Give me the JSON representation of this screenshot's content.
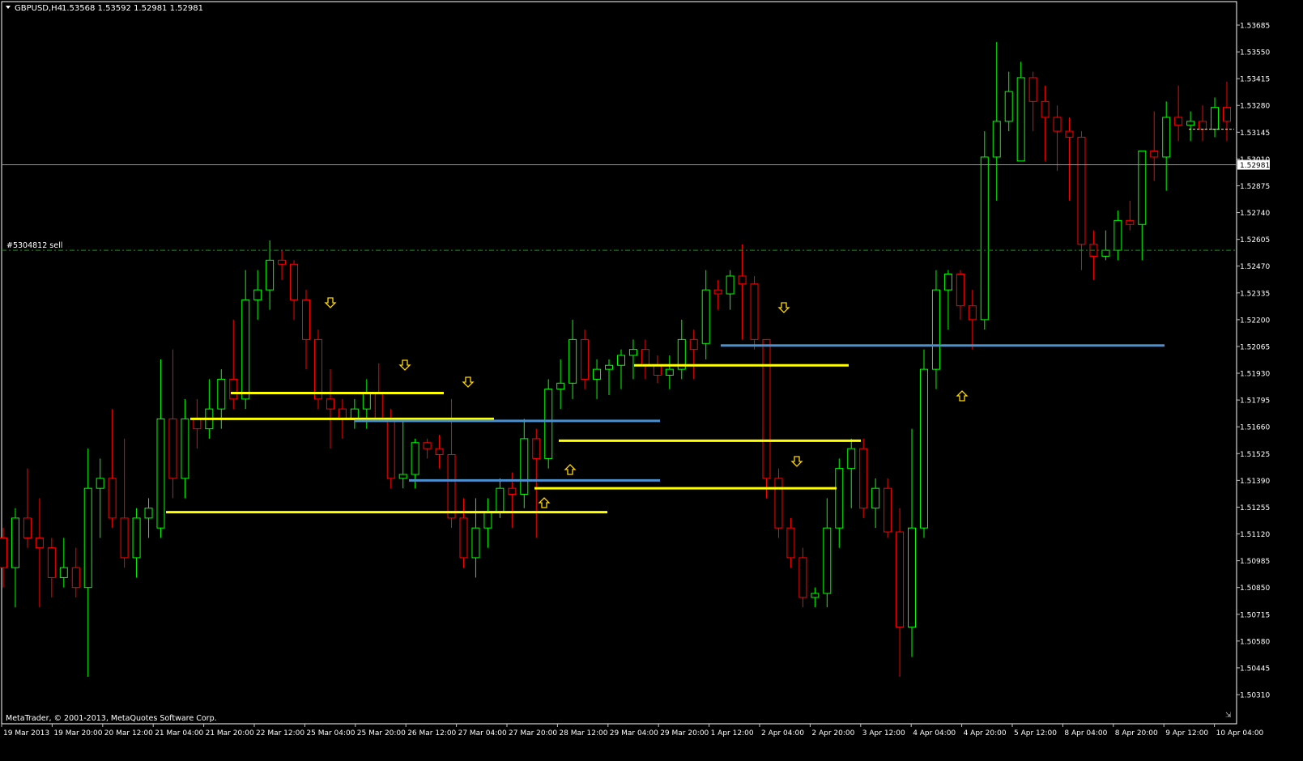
{
  "header": {
    "symbol": "GBPUSD,H4",
    "ohlc": "1.53568 1.53592 1.52981 1.52981"
  },
  "footer": {
    "copyright": "MetaTrader, © 2001-2013, MetaQuotes Software Corp."
  },
  "order": {
    "label": "#5304812 sell",
    "price": 1.5255
  },
  "current_price_label": "1.52981",
  "colors": {
    "background": "#000000",
    "bull": "#00ff00",
    "bear": "#ff0000",
    "axis": "#c0c0c0",
    "support_line": "#ffff00",
    "resistance_line": "#4a8fd0",
    "arrow": "#ffd700",
    "bid_line": "#8c96a8",
    "order_line": "#00a000"
  },
  "chart_data": {
    "type": "candlestick",
    "symbol": "GBPUSD",
    "timeframe": "H4",
    "y_range": [
      1.502,
      1.5375
    ],
    "y_ticks": [
      "1.53685",
      "1.53550",
      "1.53415",
      "1.53280",
      "1.53145",
      "1.53010",
      "1.52875",
      "1.52740",
      "1.52605",
      "1.52470",
      "1.52335",
      "1.52200",
      "1.52065",
      "1.51930",
      "1.51795",
      "1.51660",
      "1.51525",
      "1.51390",
      "1.51255",
      "1.51120",
      "1.50985",
      "1.50850",
      "1.50715",
      "1.50580",
      "1.50445",
      "1.50310"
    ],
    "x_labels": [
      "19 Mar 2013",
      "19 Mar 20:00",
      "20 Mar 12:00",
      "21 Mar 04:00",
      "21 Mar 20:00",
      "22 Mar 12:00",
      "25 Mar 04:00",
      "25 Mar 20:00",
      "26 Mar 12:00",
      "27 Mar 04:00",
      "27 Mar 20:00",
      "28 Mar 12:00",
      "29 Mar 04:00",
      "29 Mar 20:00",
      "1 Apr 12:00",
      "2 Apr 04:00",
      "2 Apr 20:00",
      "3 Apr 12:00",
      "4 Apr 04:00",
      "4 Apr 20:00",
      "5 Apr 12:00",
      "8 Apr 04:00",
      "8 Apr 20:00",
      "9 Apr 12:00",
      "10 Apr 04:00"
    ],
    "candles": [
      [
        1.511,
        1.5115,
        1.5085,
        1.5095
      ],
      [
        1.5095,
        1.5125,
        1.5075,
        1.512
      ],
      [
        1.512,
        1.5145,
        1.5105,
        1.511
      ],
      [
        1.511,
        1.513,
        1.5075,
        1.5105
      ],
      [
        1.5105,
        1.511,
        1.508,
        1.509
      ],
      [
        1.509,
        1.511,
        1.5085,
        1.5095
      ],
      [
        1.5095,
        1.5105,
        1.508,
        1.5085
      ],
      [
        1.5085,
        1.5155,
        1.504,
        1.5135
      ],
      [
        1.5135,
        1.515,
        1.511,
        1.514
      ],
      [
        1.514,
        1.5175,
        1.5115,
        1.512
      ],
      [
        1.512,
        1.516,
        1.5095,
        1.51
      ],
      [
        1.51,
        1.5125,
        1.509,
        1.512
      ],
      [
        1.512,
        1.513,
        1.511,
        1.5125
      ],
      [
        1.5115,
        1.52,
        1.511,
        1.517
      ],
      [
        1.517,
        1.5205,
        1.513,
        1.514
      ],
      [
        1.514,
        1.518,
        1.513,
        1.517
      ],
      [
        1.517,
        1.518,
        1.5155,
        1.5165
      ],
      [
        1.5165,
        1.519,
        1.516,
        1.5175
      ],
      [
        1.5175,
        1.5195,
        1.5165,
        1.519
      ],
      [
        1.519,
        1.522,
        1.5175,
        1.518
      ],
      [
        1.518,
        1.5245,
        1.5175,
        1.523
      ],
      [
        1.523,
        1.5245,
        1.522,
        1.5235
      ],
      [
        1.5235,
        1.526,
        1.5225,
        1.525
      ],
      [
        1.525,
        1.5255,
        1.524,
        1.5248
      ],
      [
        1.5248,
        1.525,
        1.522,
        1.523
      ],
      [
        1.523,
        1.5235,
        1.5195,
        1.521
      ],
      [
        1.521,
        1.5215,
        1.5175,
        1.518
      ],
      [
        1.518,
        1.5195,
        1.5155,
        1.5175
      ],
      [
        1.5175,
        1.518,
        1.516,
        1.517
      ],
      [
        1.517,
        1.518,
        1.5165,
        1.5175
      ],
      [
        1.5175,
        1.519,
        1.5165,
        1.5183
      ],
      [
        1.5183,
        1.5198,
        1.517,
        1.517
      ],
      [
        1.517,
        1.5175,
        1.5135,
        1.514
      ],
      [
        1.514,
        1.517,
        1.5135,
        1.5142
      ],
      [
        1.5142,
        1.516,
        1.5135,
        1.5158
      ],
      [
        1.5158,
        1.516,
        1.515,
        1.5155
      ],
      [
        1.5155,
        1.5162,
        1.5145,
        1.5152
      ],
      [
        1.5152,
        1.518,
        1.5115,
        1.512
      ],
      [
        1.512,
        1.513,
        1.5095,
        1.51
      ],
      [
        1.51,
        1.513,
        1.509,
        1.5115
      ],
      [
        1.5115,
        1.513,
        1.5105,
        1.5123
      ],
      [
        1.5123,
        1.514,
        1.512,
        1.5135
      ],
      [
        1.5135,
        1.5143,
        1.5115,
        1.5132
      ],
      [
        1.5132,
        1.517,
        1.5125,
        1.516
      ],
      [
        1.516,
        1.5165,
        1.511,
        1.515
      ],
      [
        1.515,
        1.519,
        1.5145,
        1.5185
      ],
      [
        1.5185,
        1.52,
        1.5175,
        1.5188
      ],
      [
        1.5188,
        1.522,
        1.518,
        1.521
      ],
      [
        1.521,
        1.5215,
        1.5185,
        1.519
      ],
      [
        1.519,
        1.52,
        1.518,
        1.5195
      ],
      [
        1.5195,
        1.52,
        1.5182,
        1.5197
      ],
      [
        1.5197,
        1.5205,
        1.5185,
        1.5202
      ],
      [
        1.5202,
        1.521,
        1.519,
        1.5205
      ],
      [
        1.5205,
        1.521,
        1.519,
        1.5197
      ],
      [
        1.5197,
        1.5202,
        1.5188,
        1.5192
      ],
      [
        1.5192,
        1.5202,
        1.5185,
        1.5195
      ],
      [
        1.5195,
        1.522,
        1.519,
        1.521
      ],
      [
        1.521,
        1.5215,
        1.519,
        1.5205
      ],
      [
        1.5208,
        1.5245,
        1.52,
        1.5235
      ],
      [
        1.5235,
        1.524,
        1.5225,
        1.5233
      ],
      [
        1.5233,
        1.5245,
        1.5225,
        1.5242
      ],
      [
        1.5242,
        1.5258,
        1.521,
        1.5238
      ],
      [
        1.5238,
        1.5242,
        1.5205,
        1.521
      ],
      [
        1.521,
        1.521,
        1.513,
        1.514
      ],
      [
        1.514,
        1.5145,
        1.511,
        1.5115
      ],
      [
        1.5115,
        1.512,
        1.5095,
        1.51
      ],
      [
        1.51,
        1.5105,
        1.5075,
        1.508
      ],
      [
        1.508,
        1.5085,
        1.5075,
        1.5082
      ],
      [
        1.5082,
        1.513,
        1.5075,
        1.5115
      ],
      [
        1.5115,
        1.515,
        1.5105,
        1.5145
      ],
      [
        1.5145,
        1.516,
        1.5125,
        1.5155
      ],
      [
        1.5155,
        1.516,
        1.512,
        1.5125
      ],
      [
        1.5125,
        1.514,
        1.5115,
        1.5135
      ],
      [
        1.5135,
        1.514,
        1.511,
        1.5113
      ],
      [
        1.5113,
        1.5125,
        1.504,
        1.5065
      ],
      [
        1.5065,
        1.5165,
        1.505,
        1.5115
      ],
      [
        1.5115,
        1.5205,
        1.511,
        1.5195
      ],
      [
        1.5195,
        1.5245,
        1.5185,
        1.5235
      ],
      [
        1.5235,
        1.5245,
        1.5215,
        1.5243
      ],
      [
        1.5243,
        1.5245,
        1.522,
        1.5227
      ],
      [
        1.5227,
        1.5235,
        1.5205,
        1.522
      ],
      [
        1.522,
        1.5315,
        1.5215,
        1.5302
      ],
      [
        1.5302,
        1.536,
        1.528,
        1.532
      ],
      [
        1.532,
        1.5345,
        1.5315,
        1.5335
      ],
      [
        1.53,
        1.535,
        1.53,
        1.5342
      ],
      [
        1.5342,
        1.5345,
        1.5315,
        1.533
      ],
      [
        1.533,
        1.5338,
        1.53,
        1.5322
      ],
      [
        1.5322,
        1.5328,
        1.5295,
        1.5315
      ],
      [
        1.5315,
        1.5322,
        1.528,
        1.5312
      ],
      [
        1.5312,
        1.5315,
        1.5245,
        1.5258
      ],
      [
        1.5258,
        1.5265,
        1.524,
        1.5252
      ],
      [
        1.5252,
        1.5265,
        1.525,
        1.5255
      ],
      [
        1.5255,
        1.5275,
        1.525,
        1.527
      ],
      [
        1.527,
        1.528,
        1.5265,
        1.5268
      ],
      [
        1.5268,
        1.5305,
        1.525,
        1.5305
      ],
      [
        1.5305,
        1.5325,
        1.529,
        1.5302
      ],
      [
        1.5302,
        1.533,
        1.5285,
        1.5322
      ],
      [
        1.5322,
        1.5338,
        1.531,
        1.5318
      ],
      [
        1.5318,
        1.5325,
        1.531,
        1.532
      ],
      [
        1.532,
        1.5328,
        1.531,
        1.5316
      ],
      [
        1.5316,
        1.5332,
        1.5312,
        1.5327
      ],
      [
        1.5327,
        1.534,
        1.531,
        1.532
      ]
    ]
  }
}
